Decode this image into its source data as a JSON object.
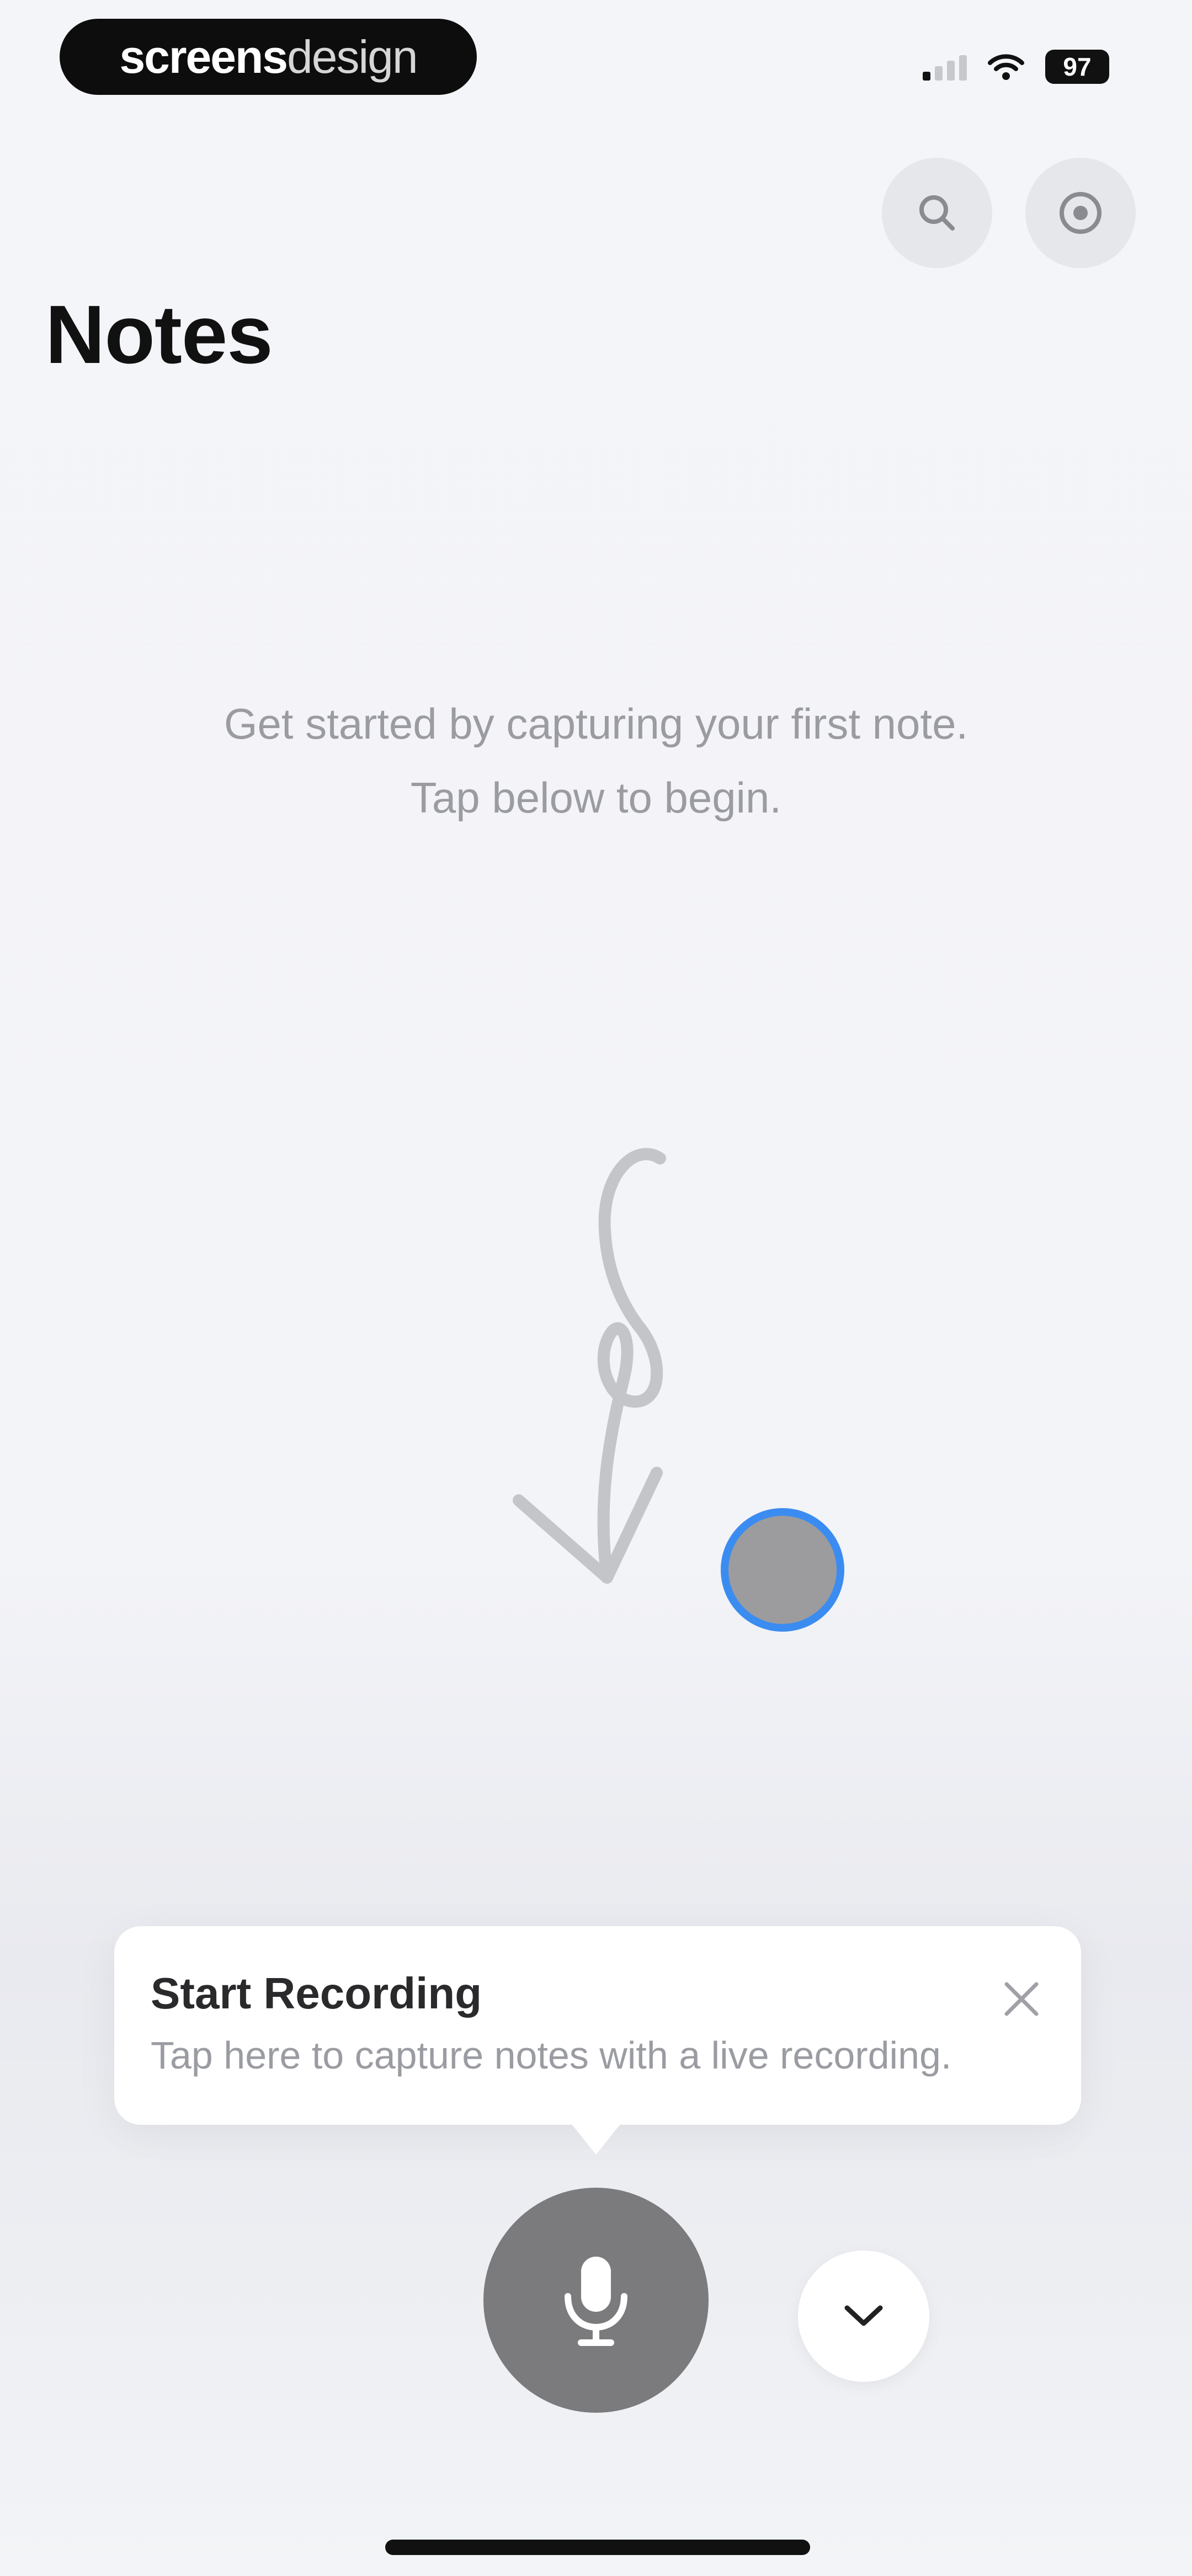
{
  "status_bar": {
    "brand_bold": "screens",
    "brand_light": "design",
    "battery": "97",
    "signal_icon": "cellular-signal-icon",
    "wifi_icon": "wifi-icon"
  },
  "header": {
    "title": "Notes",
    "search_icon": "search-icon",
    "settings_icon": "settings-icon"
  },
  "empty_state": {
    "line1": "Get started by capturing your first note.",
    "line2": "Tap below to begin."
  },
  "tooltip": {
    "title": "Start Recording",
    "body": "Tap here to capture notes with a live recording.",
    "close_icon": "close-icon"
  },
  "bottom_bar": {
    "mic_icon": "microphone-icon",
    "chevron_icon": "chevron-down-icon"
  },
  "colors": {
    "background": "#f3f4f8",
    "accent_ring": "#3b8cf0",
    "mic_button": "#7b7b7d"
  }
}
